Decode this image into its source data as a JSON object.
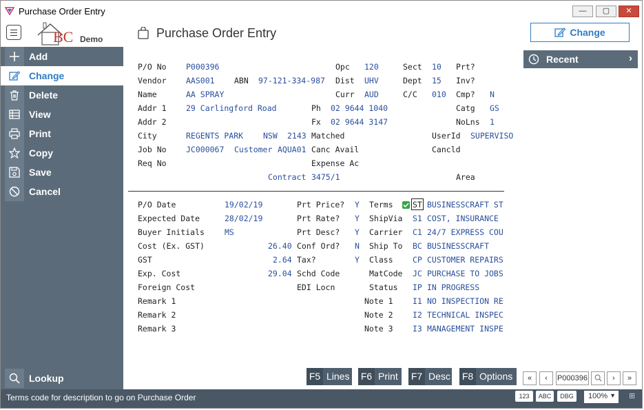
{
  "window": {
    "title": "Purchase Order Entry"
  },
  "header": {
    "brand": "BC",
    "brand_suffix": "Demo",
    "page_title": "Purchase Order Entry",
    "action_label": "Change"
  },
  "sidebar": {
    "items": [
      {
        "label": "Add",
        "icon": "plus-icon"
      },
      {
        "label": "Change",
        "icon": "edit-icon"
      },
      {
        "label": "Delete",
        "icon": "trash-icon"
      },
      {
        "label": "View",
        "icon": "table-icon"
      },
      {
        "label": "Print",
        "icon": "printer-icon"
      },
      {
        "label": "Copy",
        "icon": "star-icon"
      },
      {
        "label": "Save",
        "icon": "save-icon"
      },
      {
        "label": "Cancel",
        "icon": "cancel-icon"
      }
    ],
    "lookup": "Lookup"
  },
  "form": {
    "po_no": {
      "label": "P/O No",
      "value": "P000396"
    },
    "vendor": {
      "label": "Vendor",
      "value": "AAS001"
    },
    "abn": {
      "label": "ABN",
      "value": "97-121-334-987"
    },
    "name": {
      "label": "Name",
      "value": "AA SPRAY"
    },
    "addr1": {
      "label": "Addr 1",
      "value": "29 Carlingford Road"
    },
    "addr2": {
      "label": "Addr 2",
      "value": ""
    },
    "city": {
      "label": "City",
      "value": "REGENTS PARK",
      "state": "NSW",
      "postcode": "2143"
    },
    "job_no": {
      "label": "Job No",
      "value": "JC000067",
      "customer_label": "Customer",
      "customer": "AQUA01"
    },
    "req_no": {
      "label": "Req No",
      "value": ""
    },
    "contract": {
      "label": "Contract",
      "value": "3475/1"
    },
    "opc": {
      "label": "Opc",
      "value": "120"
    },
    "dist": {
      "label": "Dist",
      "value": "UHV"
    },
    "curr": {
      "label": "Curr",
      "value": "AUD"
    },
    "ph": {
      "label": "Ph",
      "value": "02 9644 1040"
    },
    "fx": {
      "label": "Fx",
      "value": "02 9644 3147"
    },
    "matched": {
      "label": "Matched"
    },
    "canc_avail": {
      "label": "Canc Avail"
    },
    "expense_ac": {
      "label": "Expense Ac"
    },
    "sect": {
      "label": "Sect",
      "value": "10"
    },
    "dept": {
      "label": "Dept",
      "value": "15"
    },
    "cc": {
      "label": "C/C",
      "value": "010"
    },
    "prt": {
      "label": "Prt?",
      "value": ""
    },
    "inv": {
      "label": "Inv?",
      "value": ""
    },
    "cmp": {
      "label": "Cmp?",
      "value": "N"
    },
    "catg": {
      "label": "Catg",
      "value": "GS"
    },
    "nolns": {
      "label": "NoLns",
      "value": "1"
    },
    "userid": {
      "label": "UserId",
      "value": "SUPERVISO"
    },
    "cancld": {
      "label": "Cancld",
      "value": ""
    },
    "area": {
      "label": "Area",
      "value": ""
    }
  },
  "detail": {
    "po_date": {
      "label": "P/O Date",
      "value": "19/02/19"
    },
    "expected_date": {
      "label": "Expected Date",
      "value": "28/02/19"
    },
    "buyer_initials": {
      "label": "Buyer Initials",
      "value": "MS"
    },
    "cost": {
      "label": "Cost (Ex. GST)",
      "value": "26.40"
    },
    "gst": {
      "label": "GST",
      "value": "2.64"
    },
    "exp_cost": {
      "label": "Exp. Cost",
      "value": "29.04"
    },
    "foreign_cost": {
      "label": "Foreign Cost",
      "value": ""
    },
    "remark1": {
      "label": "Remark 1",
      "value": ""
    },
    "remark2": {
      "label": "Remark 2",
      "value": ""
    },
    "remark3": {
      "label": "Remark 3",
      "value": ""
    },
    "prt_price": {
      "label": "Prt Price?",
      "value": "Y"
    },
    "prt_rate": {
      "label": "Prt Rate?",
      "value": "Y"
    },
    "prt_desc": {
      "label": "Prt Desc?",
      "value": "Y"
    },
    "conf_ord": {
      "label": "Conf Ord?",
      "value": "N"
    },
    "tax": {
      "label": "Tax?",
      "value": "Y"
    },
    "schd_code": {
      "label": "Schd Code",
      "value": ""
    },
    "edi_locn": {
      "label": "EDI Locn",
      "value": ""
    },
    "terms": {
      "label": "Terms",
      "code": "ST",
      "desc": "BUSINESSCRAFT ST"
    },
    "shipvia": {
      "label": "ShipVia",
      "code": "S1",
      "desc": "COST, INSURANCE"
    },
    "carrier": {
      "label": "Carrier",
      "code": "C1",
      "desc": "24/7 EXPRESS COU"
    },
    "ship_to": {
      "label": "Ship To",
      "code": "BC",
      "desc": "BUSINESSCRAFT"
    },
    "class": {
      "label": "Class",
      "code": "CP",
      "desc": "CUSTOMER REPAIRS"
    },
    "matcode": {
      "label": "MatCode",
      "code": "JC",
      "desc": "PURCHASE TO JOBS"
    },
    "status": {
      "label": "Status",
      "code": "IP",
      "desc": "IN PROGRESS"
    },
    "note1": {
      "label": "Note 1",
      "code": "I1",
      "desc": "NO INSPECTION RE"
    },
    "note2": {
      "label": "Note 2",
      "code": "I2",
      "desc": "TECHNICAL INSPEC"
    },
    "note3": {
      "label": "Note 3",
      "code": "I3",
      "desc": "MANAGEMENT INSPE"
    }
  },
  "fkeys": [
    {
      "key": "F5",
      "label": "Lines"
    },
    {
      "key": "F6",
      "label": "Print"
    },
    {
      "key": "F7",
      "label": "Desc"
    },
    {
      "key": "F8",
      "label": "Options"
    }
  ],
  "right": {
    "recent_label": "Recent",
    "nav_value": "P000396"
  },
  "status": {
    "message": "Terms code for description to go on Purchase Order",
    "btn1": "123",
    "btn2": "ABC",
    "btn3": "DBG",
    "zoom": "100%"
  },
  "colors": {
    "accent": "#2f7cc7",
    "sidebar": "#5b6b7a",
    "value_text": "#2a4f9c",
    "statusbar": "#4a5866"
  }
}
